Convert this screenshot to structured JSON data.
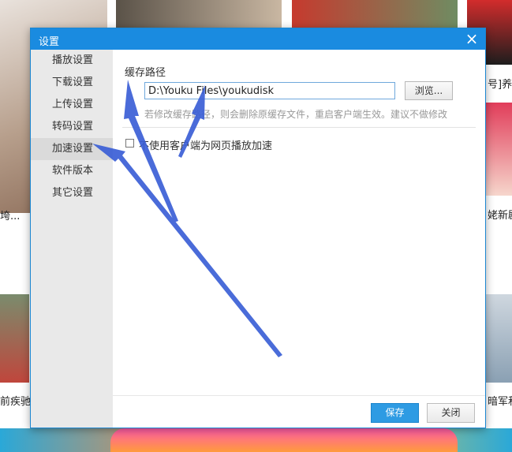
{
  "dialog": {
    "title": "设置",
    "close_icon": "×"
  },
  "sidebar": {
    "items": [
      {
        "label": "播放设置"
      },
      {
        "label": "下载设置"
      },
      {
        "label": "上传设置"
      },
      {
        "label": "转码设置"
      },
      {
        "label": "加速设置",
        "active": true
      },
      {
        "label": "软件版本"
      },
      {
        "label": "其它设置"
      }
    ]
  },
  "cache": {
    "section_label": "缓存路径",
    "path_value": "D:\\Youku Files\\youkudisk",
    "browse_label": "浏览...",
    "hint": "若修改缓存路径，则会删除原缓存文件，重启客户端生效。建议不做修改"
  },
  "acceleration": {
    "checkbox_label": "不使用客户端为网页播放加速",
    "checked": false
  },
  "footer": {
    "save_label": "保存",
    "cancel_label": "关闭"
  },
  "background_page": {
    "texts": [
      "号]养邓",
      "垮...",
      "姥新剧",
      "前疾驰",
      "暗军和"
    ]
  },
  "colors": {
    "titlebar": "#1a8be0",
    "accent_button": "#2e9be3",
    "arrow": "#3b5fd6"
  }
}
